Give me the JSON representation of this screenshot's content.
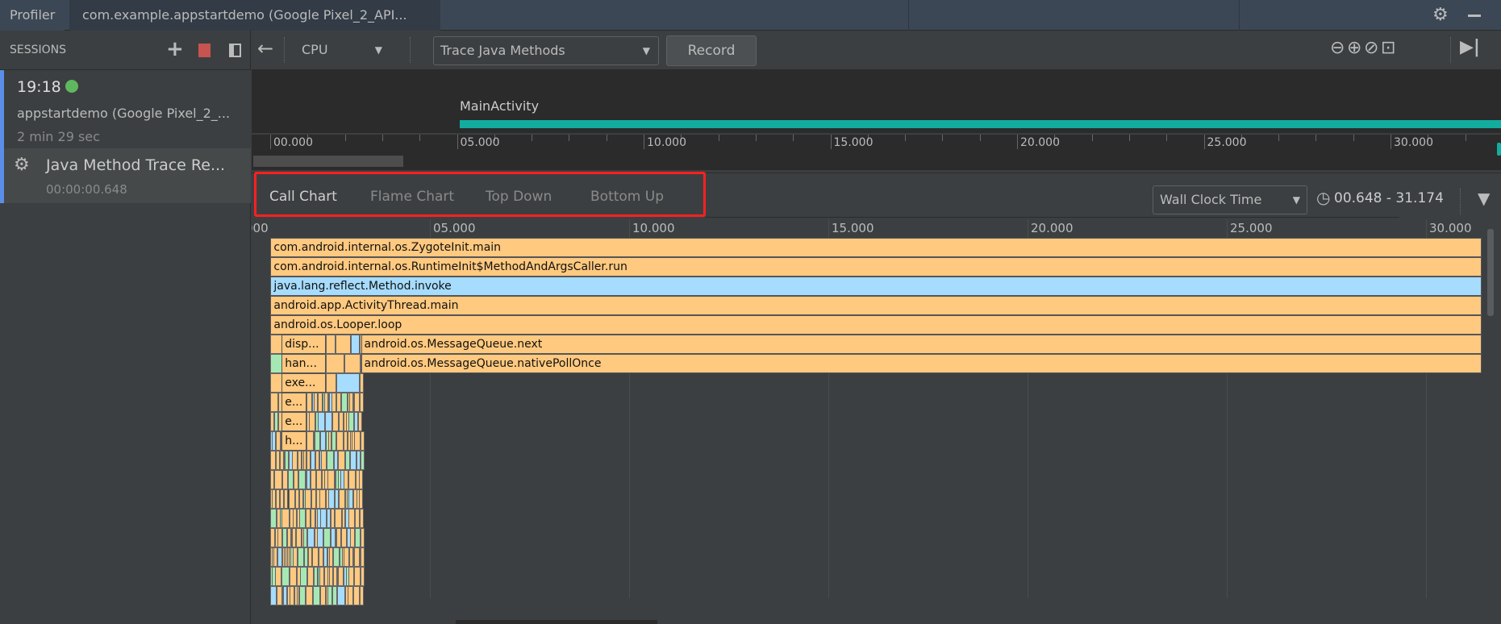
{
  "window_tabs": [
    {
      "label": "Profiler"
    },
    {
      "label": "com.example.appstartdemo (Google Pixel_2_API..."
    }
  ],
  "window_icons": [
    "gear-icon",
    "minimize-icon"
  ],
  "sessions": {
    "header": "SESSIONS",
    "icons": [
      "plus-icon",
      "stop-icon",
      "panel-icon"
    ],
    "session": {
      "time": "19:18",
      "status_color": "#5fb85f",
      "name": "appstartdemo (Google Pixel_2_...",
      "duration": "2 min 29 sec"
    },
    "trace": {
      "label": "Java Method Trace Re...",
      "duration": "00:00:00.648",
      "icon": "cpu-chip-icon"
    }
  },
  "toolbar": {
    "back_icon": "back-arrow-icon",
    "monitor": "CPU",
    "trace_config": "Trace Java Methods",
    "record_label": "Record",
    "zoom_icons": [
      "zoom-out-icon",
      "zoom-in-icon",
      "reset-zoom-icon",
      "zoom-to-selection-icon",
      "go-live-icon"
    ]
  },
  "timeline": {
    "activity": "MainActivity",
    "activity_color": "#12ad9e",
    "ticks": [
      "00.000",
      "05.000",
      "10.000",
      "15.000",
      "20.000",
      "25.000",
      "30.000"
    ]
  },
  "analysis": {
    "tabs": [
      {
        "label": "Call Chart",
        "active": true
      },
      {
        "label": "Flame Chart"
      },
      {
        "label": "Top Down"
      },
      {
        "label": "Bottom Up"
      }
    ],
    "highlight_color": "#ff2020",
    "clock_type": "Wall Clock Time",
    "range": "00.648 - 31.174"
  },
  "call_chart": {
    "ticks": [
      "000",
      "05.000",
      "10.000",
      "15.000",
      "20.000",
      "25.000",
      "30.000"
    ],
    "colors": {
      "app": "#ffc97f",
      "platform": "#a6dcfd",
      "native": "#a6e8b4"
    },
    "frames": [
      {
        "label": "com.android.internal.os.ZygoteInit.main",
        "depth": 0,
        "start": 1.0,
        "end": 31.4,
        "kind": "app"
      },
      {
        "label": "com.android.internal.os.RuntimeInit$MethodAndArgsCaller.run",
        "depth": 1,
        "start": 1.0,
        "end": 31.4,
        "kind": "app"
      },
      {
        "label": "java.lang.reflect.Method.invoke",
        "depth": 2,
        "start": 1.0,
        "end": 31.4,
        "kind": "platform"
      },
      {
        "label": "android.app.ActivityThread.main",
        "depth": 3,
        "start": 1.0,
        "end": 31.4,
        "kind": "app"
      },
      {
        "label": "android.os.Looper.loop",
        "depth": 4,
        "start": 1.0,
        "end": 31.4,
        "kind": "app"
      },
      {
        "label": "disp...",
        "depth": 5,
        "start": 1.28,
        "end": 2.39,
        "kind": "app"
      },
      {
        "label": "han...",
        "depth": 6,
        "start": 1.28,
        "end": 2.39,
        "kind": "app"
      },
      {
        "label": "exe...",
        "depth": 7,
        "start": 1.28,
        "end": 2.39,
        "kind": "app"
      },
      {
        "label": "e...",
        "depth": 8,
        "start": 1.28,
        "end": 1.9,
        "kind": "app"
      },
      {
        "label": "e...",
        "depth": 9,
        "start": 1.28,
        "end": 1.9,
        "kind": "app"
      },
      {
        "label": "h...",
        "depth": 10,
        "start": 1.28,
        "end": 1.9,
        "kind": "app"
      },
      {
        "label": "android.os.MessageQueue.next",
        "depth": 5,
        "start": 3.27,
        "end": 31.4,
        "kind": "app"
      },
      {
        "label": "android.os.MessageQueue.nativePollOnce",
        "depth": 6,
        "start": 3.27,
        "end": 31.4,
        "kind": "app"
      }
    ]
  }
}
